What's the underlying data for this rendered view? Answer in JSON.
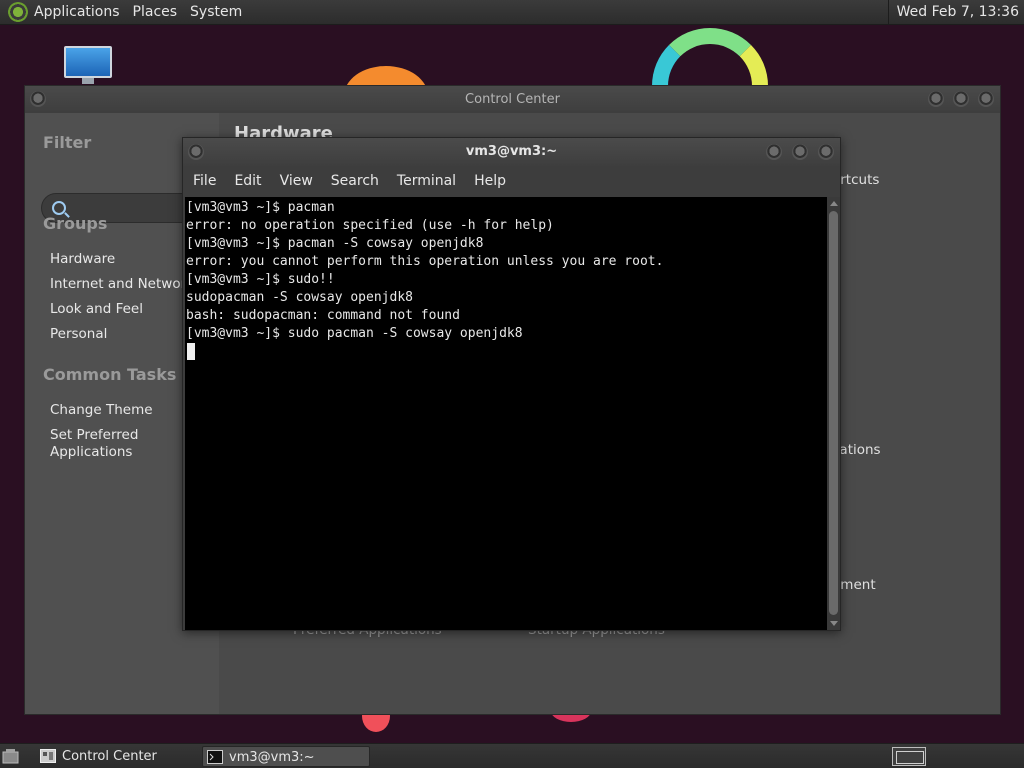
{
  "top_panel": {
    "menus": [
      "Applications",
      "Places",
      "System"
    ],
    "clock": "Wed Feb  7, 13:36"
  },
  "control_center": {
    "title": "Control Center",
    "filter_heading": "Filter",
    "groups_heading": "Groups",
    "groups": [
      "Hardware",
      "Internet and Network",
      "Look and Feel",
      "Personal"
    ],
    "common_tasks_heading": "Common Tasks",
    "tasks": [
      "Change Theme",
      "Set Preferred",
      "Applications"
    ],
    "content": {
      "heading": "Hardware",
      "partial_right_1": "ortcuts",
      "partial_right_2": "cations",
      "partial_right_3": "ement",
      "bottom_item_1": "Preferred Applications",
      "bottom_item_2": "Startup Applications"
    }
  },
  "terminal": {
    "title": "vm3@vm3:~",
    "menus": [
      "File",
      "Edit",
      "View",
      "Search",
      "Terminal",
      "Help"
    ],
    "lines": [
      "[vm3@vm3 ~]$ pacman",
      "error: no operation specified (use -h for help)",
      "[vm3@vm3 ~]$ pacman -S cowsay openjdk8",
      "error: you cannot perform this operation unless you are root.",
      "[vm3@vm3 ~]$ sudo!!",
      "sudopacman -S cowsay openjdk8",
      "bash: sudopacman: command not found",
      "[vm3@vm3 ~]$ sudo pacman -S cowsay openjdk8"
    ]
  },
  "taskbar": {
    "items": [
      "Control Center",
      "vm3@vm3:~"
    ]
  },
  "colors": {
    "terminal_bg": "#000000",
    "panel_bg": "#2c2c2c",
    "window_bg": "#464646"
  }
}
